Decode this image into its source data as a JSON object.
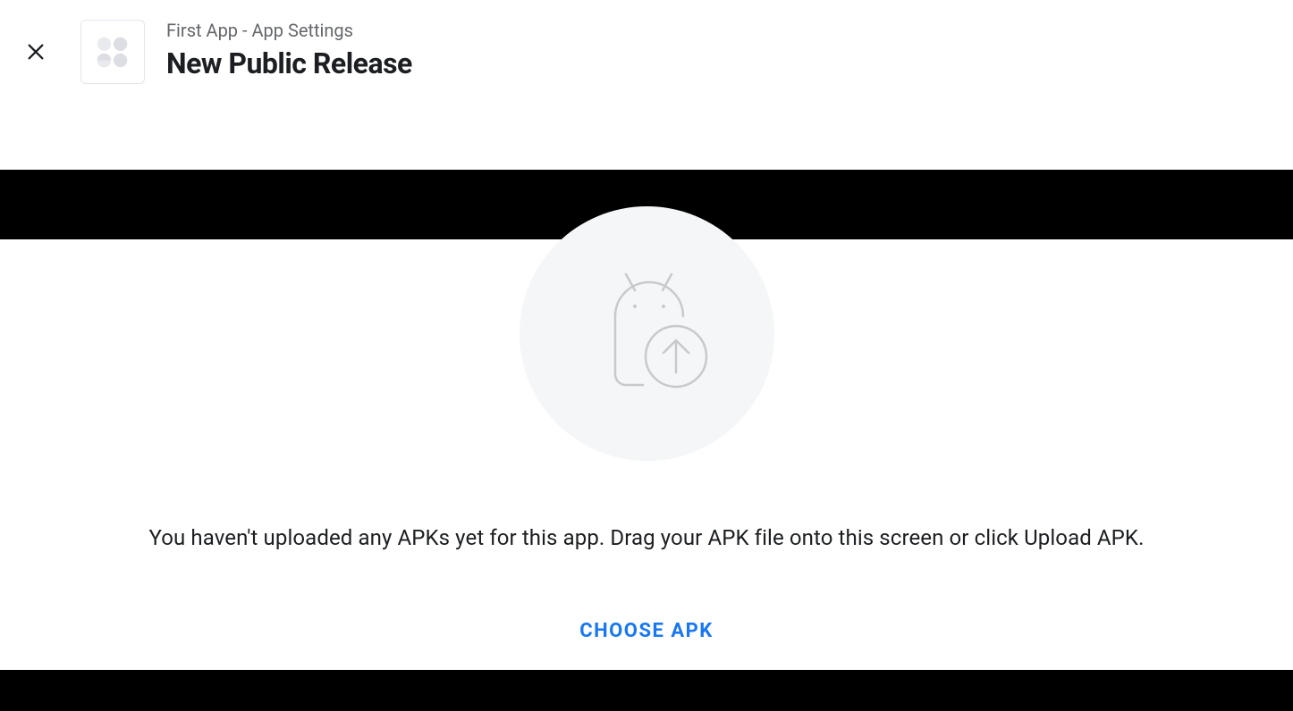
{
  "header": {
    "breadcrumb": "First App - App Settings",
    "title": "New Public Release"
  },
  "main": {
    "empty_message": "You haven't uploaded any APKs yet for this app. Drag your APK file onto this screen or click Upload APK.",
    "choose_button_label": "CHOOSE APK"
  }
}
